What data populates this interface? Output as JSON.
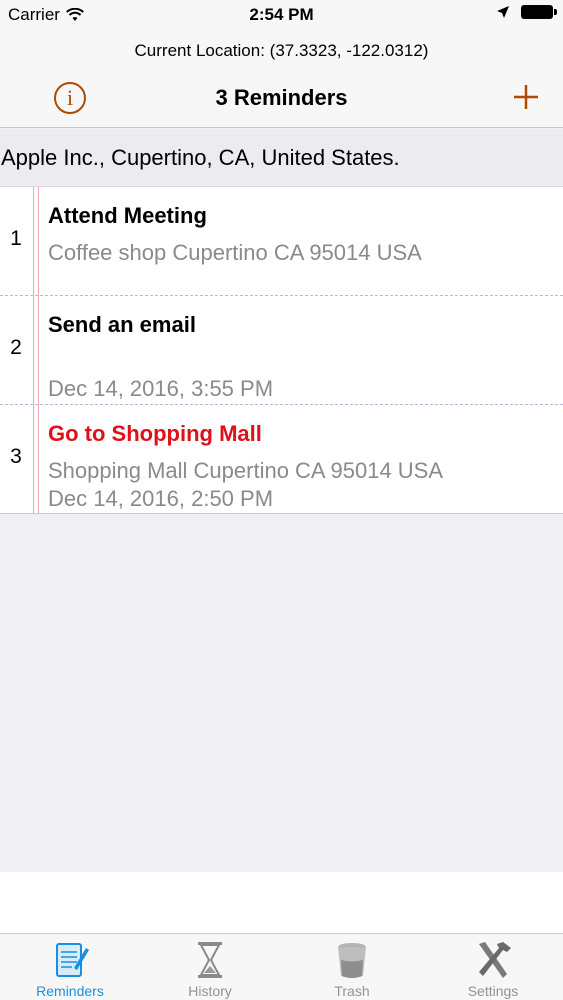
{
  "status_bar": {
    "carrier": "Carrier",
    "time": "2:54 PM"
  },
  "nav": {
    "location": "Current Location: (37.3323, -122.0312)",
    "title": "3 Reminders",
    "info_icon": "info-circle-icon",
    "add_icon": "plus-icon",
    "accent_color": "#b04a00"
  },
  "address": "Apple Inc., Cupertino, CA, United States.",
  "reminders": [
    {
      "number": "1",
      "title": "Attend Meeting",
      "location": "Coffee shop Cupertino CA 95014 USA",
      "date": ""
    },
    {
      "number": "2",
      "title": "Send an email",
      "location": "",
      "date": "Dec 14, 2016, 3:55 PM"
    },
    {
      "number": "3",
      "title": "Go to Shopping Mall",
      "location": "Shopping Mall Cupertino CA 95014 USA",
      "date": "Dec 14, 2016, 2:50 PM",
      "title_color": "#e0101a"
    }
  ],
  "tabs": [
    {
      "label": "Reminders",
      "icon": "notepad-pencil-icon",
      "active": true
    },
    {
      "label": "History",
      "icon": "hourglass-icon",
      "active": false
    },
    {
      "label": "Trash",
      "icon": "trash-can-icon",
      "active": false
    },
    {
      "label": "Settings",
      "icon": "wrench-hammer-icon",
      "active": false
    }
  ],
  "active_tab_color": "#1a8fe0"
}
